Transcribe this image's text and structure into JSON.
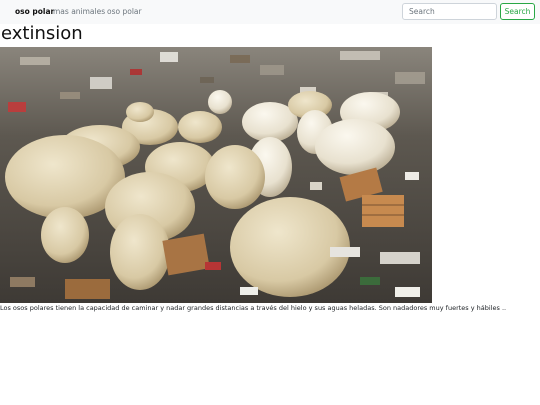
{
  "navbar": {
    "brand": "oso polar",
    "links": [
      "mas animales",
      "oso polar"
    ],
    "search": {
      "placeholder": "Search",
      "button_label": "Search"
    }
  },
  "main": {
    "title": "extinsion",
    "caption": "Los osos polares tienen la capacidad de caminar y nadar grandes distancias a través del hielo y sus aguas heladas. Son nadadores muy fuertes y hábiles .."
  }
}
